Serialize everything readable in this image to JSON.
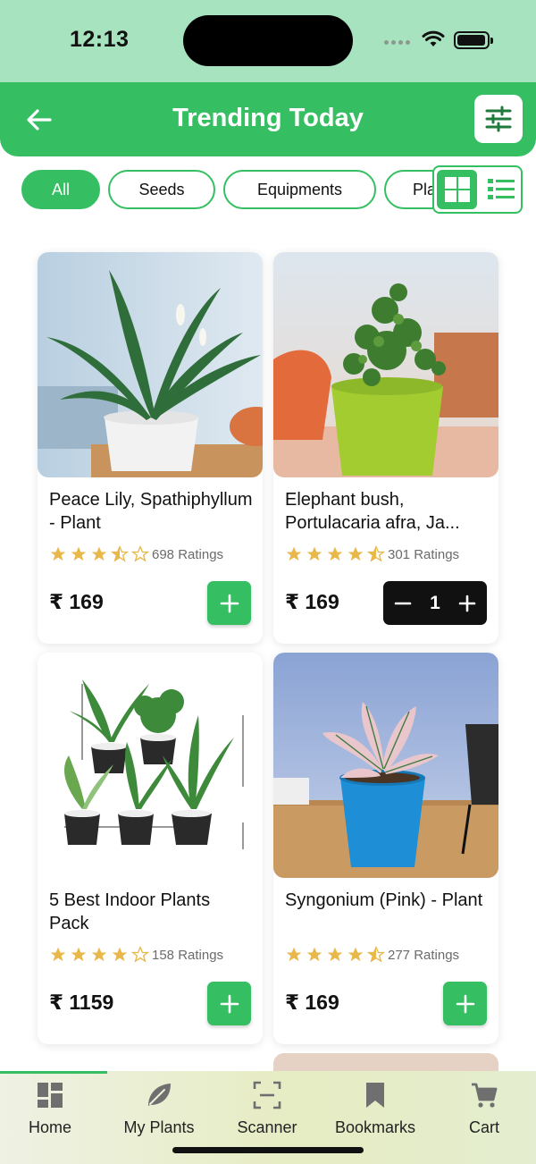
{
  "status_bar": {
    "time": "12:13"
  },
  "header": {
    "title": "Trending Today",
    "back_icon": "arrow-left-icon",
    "filter_icon": "sliders-icon"
  },
  "filter_chips": [
    {
      "label": "All",
      "active": true
    },
    {
      "label": "Seeds",
      "active": false
    },
    {
      "label": "Equipments",
      "active": false
    },
    {
      "label": "Pla",
      "active": false
    }
  ],
  "view_toggle": {
    "selected": "grid"
  },
  "products": [
    {
      "name": "Peace Lily, Spathiphyllum - Plant",
      "rating": 3.5,
      "ratings_text": "698 Ratings",
      "price": "₹ 169",
      "in_cart": false,
      "quantity": null
    },
    {
      "name": "Elephant bush, Portulacaria afra, Ja...",
      "rating": 4.5,
      "ratings_text": "301 Ratings",
      "price": "₹ 169",
      "in_cart": true,
      "quantity": "1"
    },
    {
      "name": "5 Best Indoor Plants Pack",
      "rating": 4,
      "ratings_text": "158 Ratings",
      "price": "₹ 1159",
      "in_cart": false,
      "quantity": null
    },
    {
      "name": "Syngonium (Pink) - Plant",
      "rating": 4.5,
      "ratings_text": "277 Ratings",
      "price": "₹ 169",
      "in_cart": false,
      "quantity": null
    }
  ],
  "bottom_nav": [
    {
      "label": "Home",
      "icon": "dashboard-grid-icon",
      "active": true
    },
    {
      "label": "My Plants",
      "icon": "leaf-icon",
      "active": false
    },
    {
      "label": "Scanner",
      "icon": "scan-frame-icon",
      "active": false
    },
    {
      "label": "Bookmarks",
      "icon": "bookmark-icon",
      "active": false
    },
    {
      "label": "Cart",
      "icon": "cart-icon",
      "active": false
    }
  ],
  "colors": {
    "accent": "#35bf62",
    "status_bar_bg": "#a8e3bf",
    "star": "#e8b84a",
    "stepper_bg": "#111111"
  }
}
